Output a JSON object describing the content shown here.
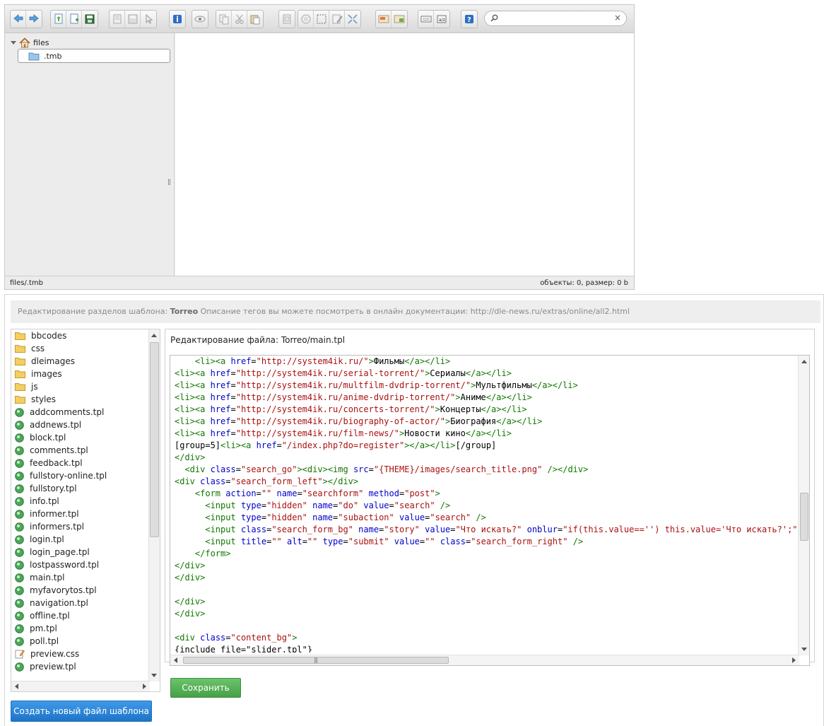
{
  "file_manager": {
    "toolbar": {
      "groups": [
        [
          "back-icon",
          "forward-icon"
        ],
        [
          "upload-icon",
          "new-file-icon",
          "save-icon"
        ],
        [
          "open-icon",
          "download-icon",
          "select-icon"
        ],
        [
          "info-icon"
        ],
        [
          "preview-icon"
        ],
        [
          "copy-icon",
          "cut-icon",
          "paste-icon"
        ],
        [
          "duplicate-icon"
        ],
        [
          "rename-icon",
          "select-all-icon",
          "edit-icon",
          "resize-icon"
        ],
        [
          "extract-icon",
          "archive-icon"
        ],
        [
          "list-view-icon",
          "sort-icon"
        ],
        [
          "help-icon"
        ]
      ],
      "search_value": "",
      "search_placeholder": "",
      "clear_glyph": "×"
    },
    "tree": {
      "root_label": "files",
      "child_label": ".tmb"
    },
    "splitter_glyph": "||",
    "status": {
      "path": "files/.tmb",
      "summary": "объекты: 0, размер: 0 b"
    }
  },
  "editor": {
    "header_prefix": "Редактирование разделов шаблона:",
    "header_template": "Torreo",
    "header_suffix": "Описание тегов вы можете посмотреть в онлайн документации: http://dle-news.ru/extras/online/all2.html",
    "files": [
      {
        "name": "bbcodes",
        "kind": "folder"
      },
      {
        "name": "css",
        "kind": "folder"
      },
      {
        "name": "dleimages",
        "kind": "folder"
      },
      {
        "name": "images",
        "kind": "folder"
      },
      {
        "name": "js",
        "kind": "folder"
      },
      {
        "name": "styles",
        "kind": "folder"
      },
      {
        "name": "addcomments.tpl",
        "kind": "tpl"
      },
      {
        "name": "addnews.tpl",
        "kind": "tpl"
      },
      {
        "name": "block.tpl",
        "kind": "tpl"
      },
      {
        "name": "comments.tpl",
        "kind": "tpl"
      },
      {
        "name": "feedback.tpl",
        "kind": "tpl"
      },
      {
        "name": "fullstory-online.tpl",
        "kind": "tpl"
      },
      {
        "name": "fullstory.tpl",
        "kind": "tpl"
      },
      {
        "name": "info.tpl",
        "kind": "tpl"
      },
      {
        "name": "informer.tpl",
        "kind": "tpl"
      },
      {
        "name": "informers.tpl",
        "kind": "tpl"
      },
      {
        "name": "login.tpl",
        "kind": "tpl"
      },
      {
        "name": "login_page.tpl",
        "kind": "tpl"
      },
      {
        "name": "lostpassword.tpl",
        "kind": "tpl"
      },
      {
        "name": "main.tpl",
        "kind": "tpl"
      },
      {
        "name": "myfavorytos.tpl",
        "kind": "tpl"
      },
      {
        "name": "navigation.tpl",
        "kind": "tpl"
      },
      {
        "name": "offline.tpl",
        "kind": "tpl"
      },
      {
        "name": "pm.tpl",
        "kind": "tpl"
      },
      {
        "name": "poll.tpl",
        "kind": "tpl"
      },
      {
        "name": "preview.css",
        "kind": "css"
      },
      {
        "name": "preview.tpl",
        "kind": "tpl"
      }
    ],
    "caption": "Редактирование файла: Torreo/main.tpl",
    "code_lines": [
      "    <li><a href=\"http://system4ik.ru/\">Фильмы</a></li>",
      "<li><a href=\"http://system4ik.ru/serial-torrent/\">Сериалы</a></li>",
      "<li><a href=\"http://system4ik.ru/multfilm-dvdrip-torrent/\">Мультфильмы</a></li>",
      "<li><a href=\"http://system4ik.ru/anime-dvdrip-torrent/\">Аниме</a></li>",
      "<li><a href=\"http://system4ik.ru/concerts-torrent/\">Концерты</a></li>",
      "<li><a href=\"http://system4ik.ru/biography-of-actor/\">Биография</a></li>",
      "<li><a href=\"http://system4ik.ru/film-news/\">Новости кино</a></li>",
      "[group=5]<li><a href=\"/index.php?do=register\"></a></li>[/group]",
      "</div>",
      "  <div class=\"search_go\"><div><img src=\"{THEME}/images/search_title.png\" /></div>",
      "<div class=\"search_form_left\"></div>",
      "    <form action=\"\" name=\"searchform\" method=\"post\">",
      "      <input type=\"hidden\" name=\"do\" value=\"search\" />",
      "      <input type=\"hidden\" name=\"subaction\" value=\"search\" />",
      "      <input class=\"search_form_bg\" name=\"story\" value=\"Что искать?\" onblur=\"if(this.value=='') this.value='Что искать?';\"",
      "      <input title=\"\" alt=\"\" type=\"submit\" value=\"\" class=\"search_form_right\" />",
      "    </form>",
      "</div>",
      "</div>",
      "",
      "</div>",
      "</div>",
      "",
      "<div class=\"content_bg\">",
      "{include file=\"slider.tpl\"}"
    ],
    "save_label": "Сохранить",
    "new_file_label": "Создать новый файл шаблона",
    "colors": {
      "tag": "#117700",
      "attr": "#0000cc",
      "string": "#aa1111",
      "save_button": "#52ad52",
      "new_button": "#2a82d4"
    }
  }
}
